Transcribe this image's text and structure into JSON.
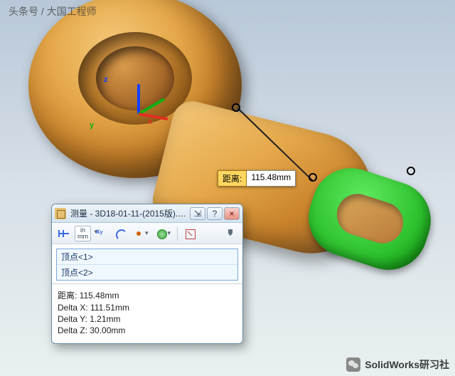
{
  "watermark": {
    "top_left": "头条号 / 大国工程师",
    "bottom_right": "SolidWorks研习社"
  },
  "triad": {
    "x": "x",
    "y": "y",
    "z": "z"
  },
  "dimension": {
    "label": "距离:",
    "value": "115.48mm"
  },
  "panel": {
    "title": "测量 - 3D18-01-11-(2015版).SL...",
    "win": {
      "pin": "⇲",
      "help": "?",
      "close": "×"
    },
    "toolbar": {
      "btn_dist": "dist",
      "unit_top": "in",
      "unit_bot": "mm",
      "btn_xyz": "xyz",
      "btn_arc": "arc",
      "btn_pt": "pt",
      "btn_globe": "globe",
      "btn_chart": "chart",
      "btn_pin": "pin"
    },
    "selection": [
      "顶点<1>",
      "顶点<2>"
    ],
    "results": {
      "distance": "距离: 115.48mm",
      "dx": "Delta X: 111.51mm",
      "dy": "Delta Y: 1.21mm",
      "dz": "Delta Z: 30.00mm"
    }
  }
}
